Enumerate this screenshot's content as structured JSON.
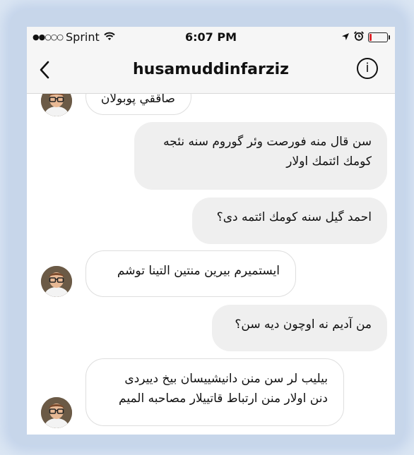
{
  "status_bar": {
    "signal_dots": "●●○○○",
    "carrier": "Sprint",
    "time": "6:07 PM",
    "battery_level": 0.15,
    "icons": [
      "wifi-icon",
      "location-arrow-icon",
      "alarm-clock-icon",
      "battery-icon"
    ]
  },
  "header": {
    "title": "husamuddinfarziz",
    "back_icon": "chevron-left-icon",
    "info_icon": "info-icon",
    "info_glyph": "i"
  },
  "messages": [
    {
      "direction": "incoming",
      "text": "صاققي پوبولان",
      "partial": true
    },
    {
      "direction": "outgoing",
      "lines": [
        "سن قال منه فورصت وئر گوروم سنه نئجه",
        "كومك ائتمك اولار"
      ]
    },
    {
      "direction": "outgoing",
      "lines": [
        "احمد گيل سنه كومك ائتمه دی؟"
      ]
    },
    {
      "direction": "incoming",
      "lines": [
        "ايستميرم بيرين منتين التينا توشم"
      ]
    },
    {
      "direction": "outgoing",
      "lines": [
        "من آديم نه اوچون ديه سن؟"
      ]
    },
    {
      "direction": "incoming",
      "lines": [
        "بيليب لر سن منن دانيشييسان بيخ دييردی",
        "دنن اولار منن ارتباط قاتييلار مصاحبه الميم"
      ]
    }
  ],
  "colors": {
    "outgoing_bubble": "#efefef",
    "incoming_bubble": "#ffffff",
    "bar_background": "#f6f6f6",
    "battery_low": "#e0262b"
  }
}
